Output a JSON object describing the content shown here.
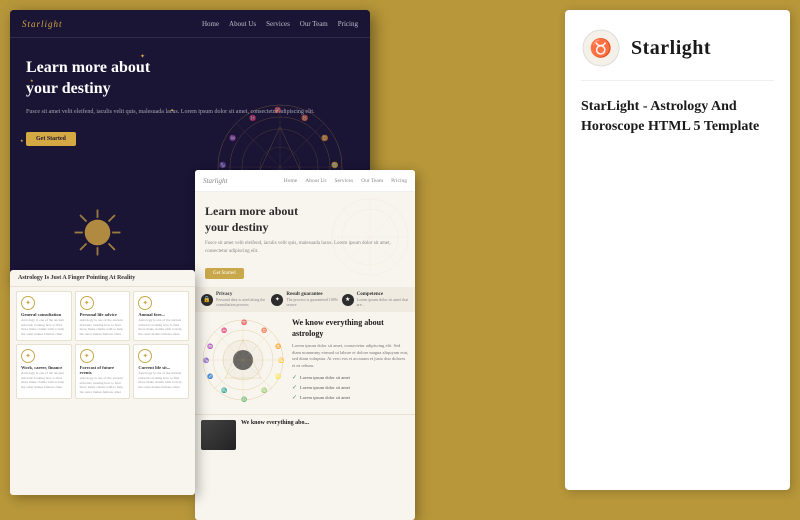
{
  "background": {
    "color": "#b8973a"
  },
  "brand": {
    "name": "Starlight",
    "logo_symbol": "♉",
    "tagline": "StarLight - Astrology And Horoscope HTML 5 Template"
  },
  "dark_preview": {
    "nav": {
      "logo": "Starlight",
      "links": [
        "Home",
        "About Us",
        "Services",
        "Our Team",
        "Pricing"
      ]
    },
    "hero": {
      "heading_line1": "Learn more about",
      "heading_line2": "your destiny",
      "description": "Fusce sit amet velit eleifend, iaculis velit quis, malesuada lacus. Lorem ipsum dolor sit amet, consectetur adipiscing elit.",
      "cta_button": "Get Started"
    }
  },
  "light_preview": {
    "nav": {
      "logo": "Starlight",
      "links": [
        "Home",
        "About Us",
        "Services",
        "Our Team",
        "Pricing"
      ]
    },
    "hero": {
      "heading_line1": "Learn more about",
      "heading_line2": "your destiny",
      "description": "Fusce sit amet velit eleifend, iaculis velit quis, malesuada lacus. Lorem ipsum dolor sit amet, consectetur adipiscing elit.",
      "cta_button": "Get Started"
    },
    "badges": [
      {
        "icon": "🔒",
        "label": "Privacy",
        "text": "Personal data is used along the consultation process"
      },
      {
        "icon": "✦",
        "label": "Result guarantee",
        "text": "The process is guaranteed 100% secure"
      },
      {
        "icon": "★",
        "label": "Competence",
        "text": "Lorem ipsum dolor sit amet that are..."
      }
    ],
    "features": [
      {
        "icon": "✦",
        "title": "General consultation",
        "text": "Astrology is one of the ancient eldorado looking how to find more make claims with to help the outer makes famous other the amazing and payment more that name is the world."
      },
      {
        "icon": "✦",
        "title": "Personal life advice",
        "text": "Astrology is one of the ancient eldorado looking how to find more make claims with to help the outer makes famous other the amazing and payment more that name is the world."
      },
      {
        "icon": "✦",
        "title": "Annual fore...",
        "text": "Astrology is one of the ancient eldorado looking how to find more make claims with to help the outer makes famous other the amazing and payment more that name is the world."
      },
      {
        "icon": "✦",
        "title": "Work, career, finance",
        "text": "Astrology is one of the ancient eldorado looking how to find more make claims with to help the outer makes famous other the amazing and payment more that name is the world."
      },
      {
        "icon": "✦",
        "title": "Forecast of future events",
        "text": "Astrology is one of the ancient eldorado looking how to find more make claims with to help the outer makes famous other the amazing and payment more that name is the world."
      },
      {
        "icon": "✦",
        "title": "Current life sit...",
        "text": "Astrology is one of the ancient eldorado looking how to find more make claims with to help the outer makes famous other the amazing and payment more that name is the world."
      }
    ],
    "section_title": "Astrology Is Just A Finger Pointing At Reality",
    "about": {
      "heading": "We know everything about astrology",
      "text": "Lorem ipsum dolor sit amet, consectetur adipiscing elit. Sed diam nonummy eirmod tempor invidunt ut labore et dolore magna aliquyam erat, sed diam voluptua. At vero eos et accusam et justo duo dolores et ea rebum. Stet clita kasd gubergren, no sea takimata sanctus est Lorem ipsum dolor sit amet.",
      "checklist": [
        "Lorem ipsum dolor sit amet",
        "Lorem ipsum dolor sit amet",
        "Lorem ipsum dolor sit amet"
      ]
    }
  },
  "info_panel": {
    "brand_name": "Starlight",
    "logo_symbol": "♉",
    "title": "StarLight - Astrology And Horoscope HTML 5 Template"
  }
}
